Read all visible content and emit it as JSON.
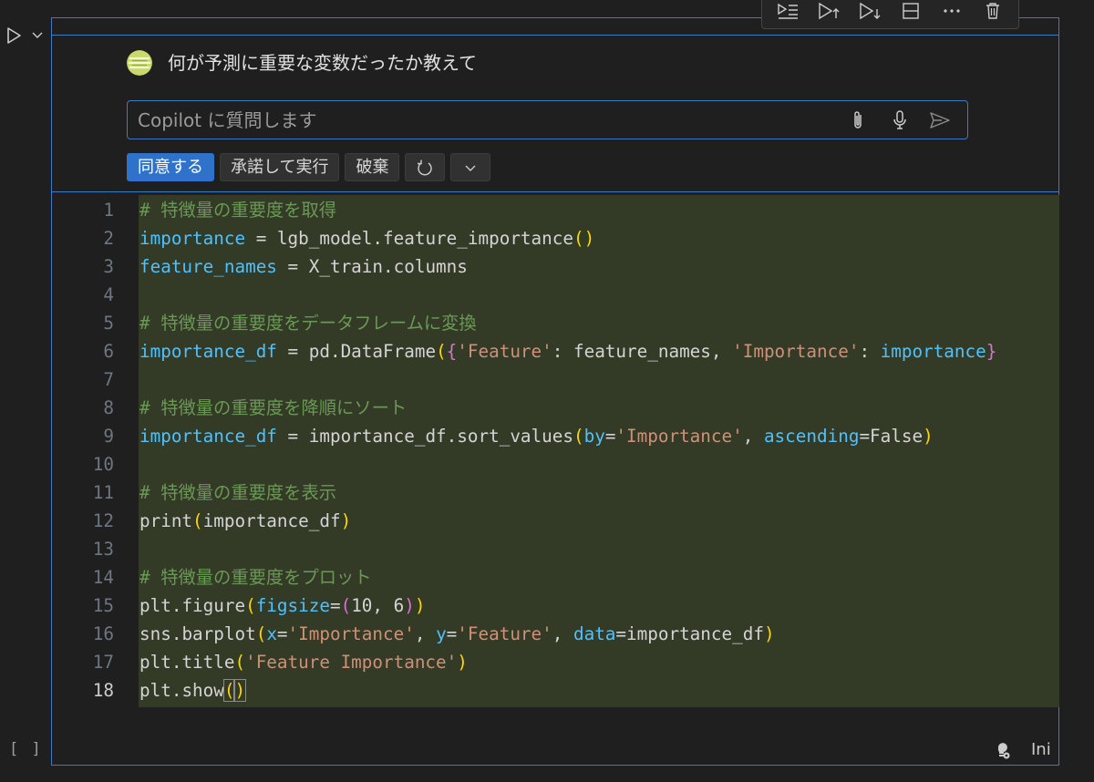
{
  "toolbar": {
    "icons": [
      "execute-above-icon",
      "run-above-icon",
      "run-below-icon",
      "split-cell-icon",
      "more-icon",
      "delete-icon"
    ]
  },
  "chat": {
    "question": "何が予測に重要な変数だったか教えて",
    "input_placeholder": "Copilot に質問します",
    "actions": {
      "accept": "同意する",
      "accept_run": "承諾して実行",
      "discard": "破棄"
    }
  },
  "code_lines": [
    {
      "num": "1",
      "text": "# 特徴量の重要度を取得"
    },
    {
      "num": "2",
      "text": "importance = lgb_model.feature_importance()"
    },
    {
      "num": "3",
      "text": "feature_names = X_train.columns"
    },
    {
      "num": "4",
      "text": ""
    },
    {
      "num": "5",
      "text": "# 特徴量の重要度をデータフレームに変換"
    },
    {
      "num": "6",
      "text": "importance_df = pd.DataFrame({'Feature': feature_names, 'Importance': importance}"
    },
    {
      "num": "7",
      "text": ""
    },
    {
      "num": "8",
      "text": "# 特徴量の重要度を降順にソート"
    },
    {
      "num": "9",
      "text": "importance_df = importance_df.sort_values(by='Importance', ascending=False)"
    },
    {
      "num": "10",
      "text": ""
    },
    {
      "num": "11",
      "text": "# 特徴量の重要度を表示"
    },
    {
      "num": "12",
      "text": "print(importance_df)"
    },
    {
      "num": "13",
      "text": ""
    },
    {
      "num": "14",
      "text": "# 特徴量の重要度をプロット"
    },
    {
      "num": "15",
      "text": "plt.figure(figsize=(10, 6))"
    },
    {
      "num": "16",
      "text": "sns.barplot(x='Importance', y='Feature', data=importance_df)"
    },
    {
      "num": "17",
      "text": "plt.title('Feature Importance')"
    },
    {
      "num": "18",
      "text": "plt.show()"
    }
  ],
  "cell": {
    "execution_count": "[ ]",
    "language": "Ini"
  },
  "colors": {
    "accent": "#3b79c9",
    "primary_button": "#2f72c9",
    "diff_highlight": "#333a26"
  }
}
